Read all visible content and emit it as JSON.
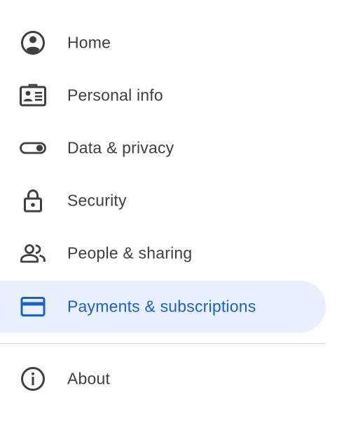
{
  "nav": {
    "items": [
      {
        "label": "Home",
        "icon": "account-circle-icon",
        "active": false
      },
      {
        "label": "Personal info",
        "icon": "id-card-icon",
        "active": false
      },
      {
        "label": "Data & privacy",
        "icon": "toggle-icon",
        "active": false
      },
      {
        "label": "Security",
        "icon": "lock-icon",
        "active": false
      },
      {
        "label": "People & sharing",
        "icon": "people-icon",
        "active": false
      },
      {
        "label": "Payments & subscriptions",
        "icon": "credit-card-icon",
        "active": true
      }
    ],
    "footer_items": [
      {
        "label": "About",
        "icon": "info-icon",
        "active": false
      }
    ]
  },
  "colors": {
    "text": "#3c4043",
    "icon": "#5f6368",
    "active_bg": "#e8f0fe",
    "active_text": "#1a60d2",
    "divider": "#dadce0"
  }
}
